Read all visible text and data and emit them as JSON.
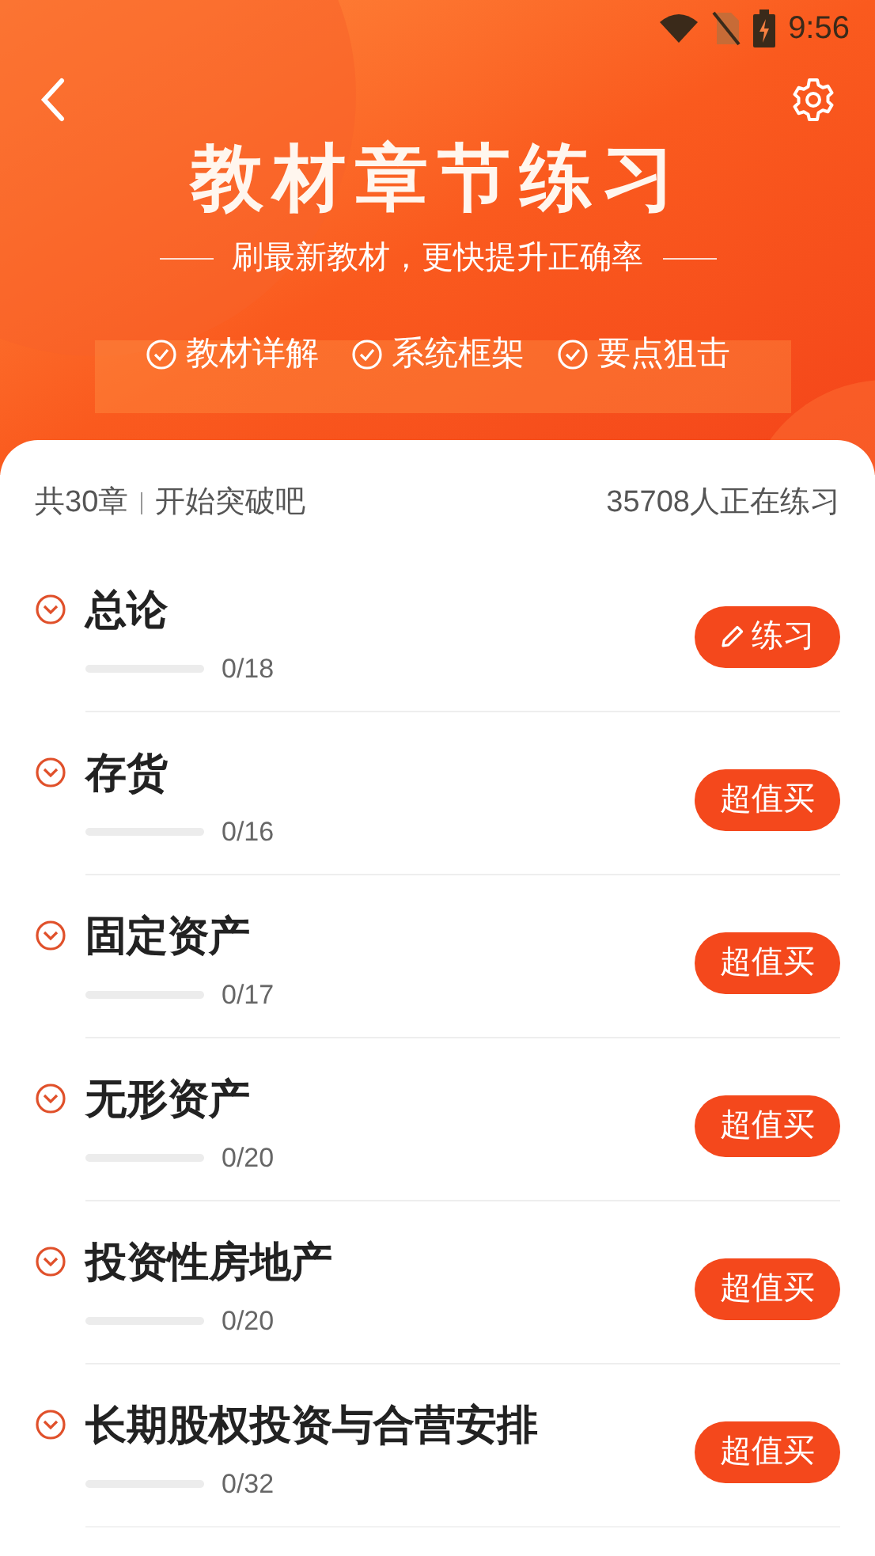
{
  "status_bar": {
    "time": "9:56"
  },
  "header": {
    "title": "教材章节练习",
    "subtitle": "刷最新教材，更快提升正确率",
    "features": [
      "教材详解",
      "系统框架",
      "要点狙击"
    ]
  },
  "summary": {
    "chapters": "共30章",
    "slogan": "开始突破吧",
    "learners": "35708人正在练习"
  },
  "chapters": [
    {
      "title": "总论",
      "progress": "0/18",
      "level": 0,
      "expanded": false,
      "action": {
        "kind": "practice",
        "label": "练习"
      }
    },
    {
      "title": "存货",
      "progress": "0/16",
      "level": 0,
      "expanded": false,
      "action": {
        "kind": "buy",
        "label": "超值买"
      }
    },
    {
      "title": "固定资产",
      "progress": "0/17",
      "level": 0,
      "expanded": false,
      "action": {
        "kind": "buy",
        "label": "超值买"
      }
    },
    {
      "title": "无形资产",
      "progress": "0/20",
      "level": 0,
      "expanded": false,
      "action": {
        "kind": "buy",
        "label": "超值买"
      }
    },
    {
      "title": "投资性房地产",
      "progress": "0/20",
      "level": 0,
      "expanded": false,
      "action": {
        "kind": "buy",
        "label": "超值买"
      }
    },
    {
      "title": "长期股权投资与合营安排",
      "progress": "0/32",
      "level": 0,
      "expanded": false,
      "action": {
        "kind": "buy",
        "label": "超值买"
      }
    }
  ]
}
